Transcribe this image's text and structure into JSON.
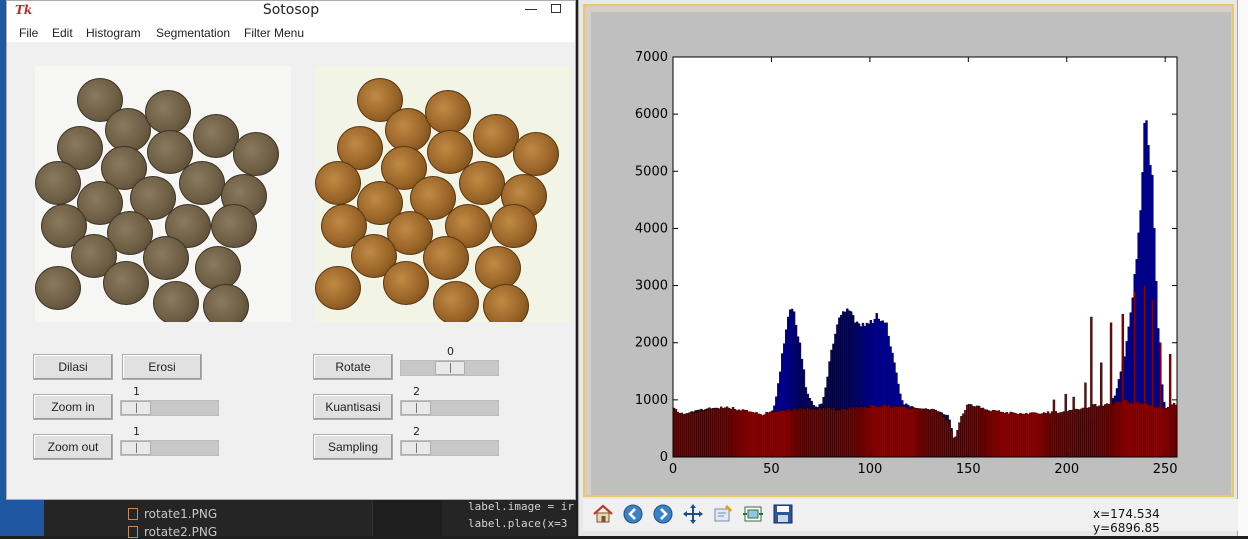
{
  "tk": {
    "title": "Sotosop",
    "logo": "Tk",
    "menu": [
      "File",
      "Edit",
      "Histogram",
      "Segmentation",
      "Filter Menu"
    ],
    "buttons": {
      "dilasi": "Dilasi",
      "erosi": "Erosi",
      "zoom_in": "Zoom in",
      "zoom_out": "Zoom out",
      "rotate": "Rotate",
      "kuantisasi": "Kuantisasi",
      "sampling": "Sampling"
    },
    "sliders": {
      "zoom_in": "1",
      "zoom_out": "1",
      "rotate": "0",
      "kuantisasi": "2",
      "sampling": "2"
    }
  },
  "background": {
    "files": [
      "rotate1.PNG",
      "rotate2.PNG"
    ],
    "code": [
      "label.image = ir",
      "label.place(x=3"
    ]
  },
  "mpl": {
    "coords": {
      "x": "x=174.534",
      "y": "y=6896.85"
    },
    "toolbar_icons": [
      "home-icon",
      "back-icon",
      "forward-icon",
      "pan-icon",
      "zoom-icon",
      "subplots-icon",
      "save-icon"
    ]
  },
  "chart_data": {
    "type": "bar",
    "title": "",
    "xlabel": "",
    "ylabel": "",
    "xlim": [
      0,
      256
    ],
    "ylim": [
      0,
      7000
    ],
    "xticks": [
      0,
      50,
      100,
      150,
      200,
      250
    ],
    "yticks": [
      0,
      1000,
      2000,
      3000,
      4000,
      5000,
      6000,
      7000
    ],
    "series": [
      {
        "color": "#00008b",
        "anchors": [
          [
            0,
            900
          ],
          [
            2,
            680
          ],
          [
            5,
            700
          ],
          [
            10,
            780
          ],
          [
            20,
            820
          ],
          [
            30,
            780
          ],
          [
            40,
            720
          ],
          [
            48,
            650
          ],
          [
            52,
            900
          ],
          [
            55,
            1600
          ],
          [
            58,
            2300
          ],
          [
            60,
            2550
          ],
          [
            62,
            2400
          ],
          [
            65,
            1800
          ],
          [
            68,
            1100
          ],
          [
            72,
            850
          ],
          [
            76,
            900
          ],
          [
            80,
            1700
          ],
          [
            84,
            2300
          ],
          [
            88,
            2550
          ],
          [
            92,
            2350
          ],
          [
            96,
            2250
          ],
          [
            100,
            2300
          ],
          [
            104,
            2400
          ],
          [
            108,
            2300
          ],
          [
            112,
            1700
          ],
          [
            116,
            950
          ],
          [
            120,
            850
          ],
          [
            130,
            800
          ],
          [
            140,
            700
          ],
          [
            143,
            250
          ],
          [
            147,
            550
          ],
          [
            150,
            850
          ],
          [
            160,
            750
          ],
          [
            170,
            700
          ],
          [
            180,
            680
          ],
          [
            190,
            620
          ],
          [
            200,
            560
          ],
          [
            208,
            520
          ],
          [
            215,
            650
          ],
          [
            220,
            700
          ],
          [
            225,
            1100
          ],
          [
            230,
            1800
          ],
          [
            233,
            2600
          ],
          [
            236,
            3500
          ],
          [
            238,
            4500
          ],
          [
            240,
            6100
          ],
          [
            242,
            5200
          ],
          [
            244,
            4500
          ],
          [
            246,
            2500
          ],
          [
            248,
            1400
          ],
          [
            250,
            800
          ],
          [
            255,
            700
          ]
        ]
      },
      {
        "color": "#8b0000",
        "anchors": [
          [
            0,
            820
          ],
          [
            5,
            720
          ],
          [
            15,
            800
          ],
          [
            25,
            850
          ],
          [
            35,
            800
          ],
          [
            45,
            720
          ],
          [
            55,
            800
          ],
          [
            65,
            820
          ],
          [
            75,
            830
          ],
          [
            85,
            820
          ],
          [
            95,
            850
          ],
          [
            105,
            880
          ],
          [
            115,
            850
          ],
          [
            125,
            820
          ],
          [
            135,
            780
          ],
          [
            140,
            600
          ],
          [
            143,
            270
          ],
          [
            146,
            650
          ],
          [
            150,
            900
          ],
          [
            160,
            800
          ],
          [
            170,
            750
          ],
          [
            180,
            730
          ],
          [
            190,
            750
          ],
          [
            200,
            760
          ],
          [
            210,
            850
          ],
          [
            220,
            900
          ],
          [
            230,
            950
          ],
          [
            240,
            900
          ],
          [
            250,
            820
          ],
          [
            255,
            900
          ]
        ],
        "spikes": [
          [
            193,
            1000
          ],
          [
            199,
            1100
          ],
          [
            203,
            1050
          ],
          [
            209,
            1300
          ],
          [
            212,
            2450
          ],
          [
            217,
            1650
          ],
          [
            222,
            2350
          ],
          [
            228,
            2500
          ],
          [
            234,
            2900
          ],
          [
            239,
            3000
          ],
          [
            243,
            2750
          ],
          [
            247,
            2000
          ],
          [
            252,
            1800
          ]
        ]
      }
    ]
  }
}
